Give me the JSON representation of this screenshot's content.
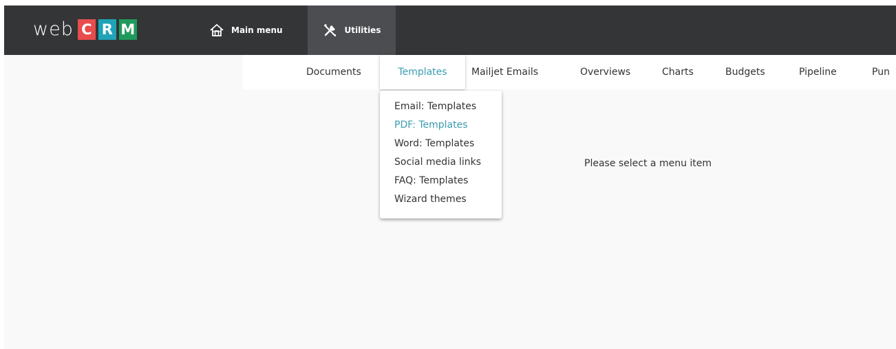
{
  "logo": {
    "text": "web",
    "letters": [
      {
        "char": "C",
        "color": "#e84c4c"
      },
      {
        "char": "R",
        "color": "#1fa3b7"
      },
      {
        "char": "M",
        "color": "#1f9a5c"
      }
    ]
  },
  "topnav": {
    "main_menu_label": "Main menu",
    "main_menu_icon": "home-icon",
    "utilities_label": "Utilities",
    "utilities_icon": "tools-icon"
  },
  "tabs": [
    {
      "label": "Documents"
    },
    {
      "label": "Templates",
      "active": true
    },
    {
      "label": "Mailjet Emails"
    },
    {
      "label": "Overviews"
    },
    {
      "label": "Charts"
    },
    {
      "label": "Budgets"
    },
    {
      "label": "Pipeline"
    },
    {
      "label": "Pun"
    }
  ],
  "dropdown": {
    "items": [
      {
        "label": "Email: Templates"
      },
      {
        "label": "PDF: Templates",
        "hover": true
      },
      {
        "label": "Word: Templates"
      },
      {
        "label": "Social media links"
      },
      {
        "label": "FAQ: Templates"
      },
      {
        "label": "Wizard themes"
      }
    ]
  },
  "main": {
    "placeholder": "Please select a menu item"
  },
  "colors": {
    "topbar": "#333537",
    "accent": "#3a9cb0",
    "active_nav": "#4b4d50",
    "background": "#f9f9f9"
  }
}
